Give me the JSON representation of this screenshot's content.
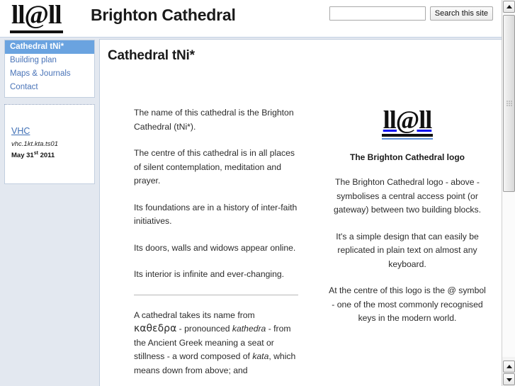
{
  "header": {
    "logo_mark": "ll@ll",
    "site_title": "Brighton Cathedral",
    "search": {
      "value": "",
      "placeholder": "",
      "button_label": "Search this site"
    }
  },
  "sidebar": {
    "nav": [
      {
        "label": "Cathedral tNi*",
        "active": true
      },
      {
        "label": "Building plan",
        "active": false
      },
      {
        "label": "Maps & Journals",
        "active": false
      },
      {
        "label": "Contact",
        "active": false
      }
    ],
    "vhc": {
      "link": "VHC",
      "code": "vhc.1kt.kta.ts01",
      "date_main": "May 31",
      "date_sup": "st",
      "date_year": "2011"
    }
  },
  "main": {
    "page_title": "Cathedral tNi*",
    "left_paragraphs": [
      "The name of this cathedral is the Brighton Cathedral (tNi*).",
      "The centre of this cathedral is in all places of silent contemplation, meditation and prayer.",
      "Its foundations are in a history of inter-faith initiatives.",
      "Its doors, walls and widows appear online.",
      "Its interior is infinite and ever-changing."
    ],
    "etymology": {
      "lead": "A cathedral takes its name from ",
      "greek": "καθεδρα",
      "mid": " - pronounced ",
      "transliteration": "kathedra",
      "tail": " - from the Ancient Greek meaning a seat or stillness - a word composed of ",
      "word1": "kata",
      "tail2": ", which means down from above; and"
    },
    "right": {
      "logo_mark": "ll@ll",
      "caption": "The Brighton Cathedral logo",
      "paragraphs": [
        "The Brighton Cathedral logo - above - symbolises a central access point (or gateway) between two building blocks.",
        "It's a simple design that can easily be replicated in plain text on almost any keyboard.",
        "At the centre of this logo is the @ symbol - one of the most commonly recognised keys in the modern world."
      ]
    }
  },
  "scrollbar": {
    "up_icon": "triangle-up",
    "down_icon": "triangle-down"
  },
  "colors": {
    "accent_blue": "#6aa3e0",
    "link_blue": "#4a74b8",
    "page_bg": "#e3e8f0"
  }
}
